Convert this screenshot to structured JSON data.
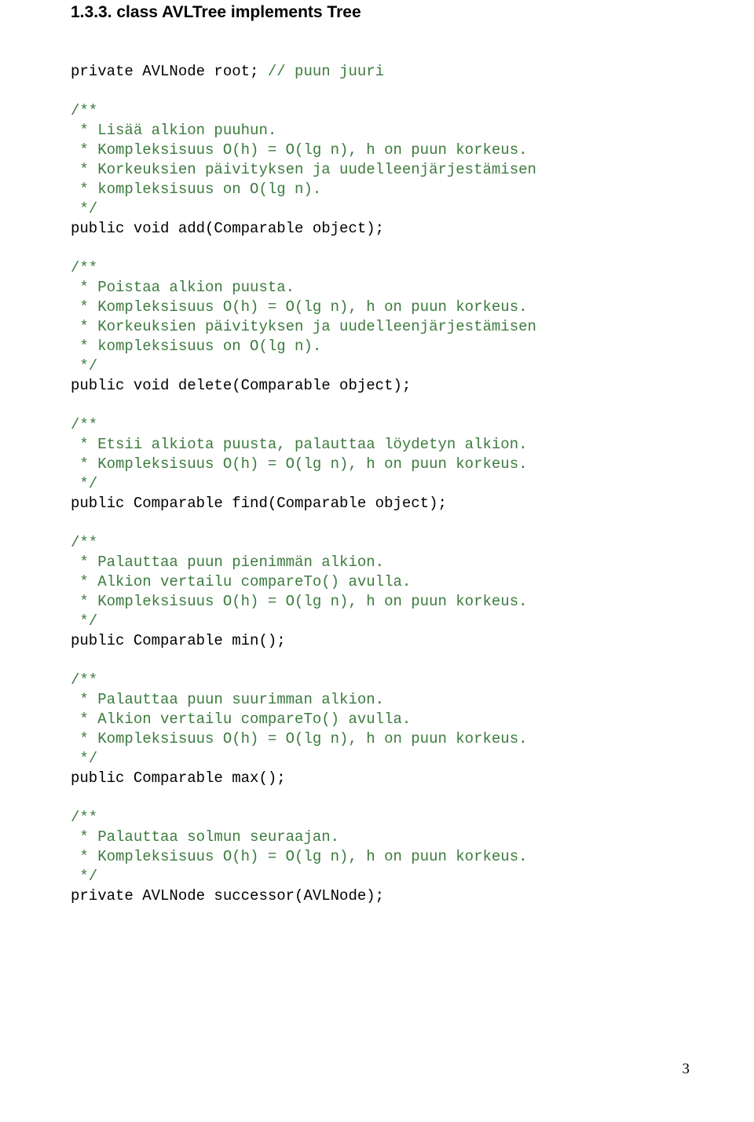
{
  "heading": "1.3.3. class AVLTree implements Tree",
  "lines": [
    {
      "kind": "blank"
    },
    {
      "kind": "mixed",
      "code": "private AVLNode root; ",
      "comment": "// puun juuri"
    },
    {
      "kind": "blank"
    },
    {
      "kind": "comment",
      "text": "/**"
    },
    {
      "kind": "comment",
      "text": " * Lisää alkion puuhun."
    },
    {
      "kind": "comment",
      "text": " * Kompleksisuus O(h) = O(lg n), h on puun korkeus."
    },
    {
      "kind": "comment",
      "text": " * Korkeuksien päivityksen ja uudelleenjärjestämisen"
    },
    {
      "kind": "comment",
      "text": " * kompleksisuus on O(lg n)."
    },
    {
      "kind": "comment",
      "text": " */"
    },
    {
      "kind": "code",
      "text": "public void add(Comparable object);"
    },
    {
      "kind": "blank"
    },
    {
      "kind": "comment",
      "text": "/**"
    },
    {
      "kind": "comment",
      "text": " * Poistaa alkion puusta."
    },
    {
      "kind": "comment",
      "text": " * Kompleksisuus O(h) = O(lg n), h on puun korkeus."
    },
    {
      "kind": "comment",
      "text": " * Korkeuksien päivityksen ja uudelleenjärjestämisen"
    },
    {
      "kind": "comment",
      "text": " * kompleksisuus on O(lg n)."
    },
    {
      "kind": "comment",
      "text": " */"
    },
    {
      "kind": "code",
      "text": "public void delete(Comparable object);"
    },
    {
      "kind": "blank"
    },
    {
      "kind": "comment",
      "text": "/**"
    },
    {
      "kind": "comment",
      "text": " * Etsii alkiota puusta, palauttaa löydetyn alkion."
    },
    {
      "kind": "comment",
      "text": " * Kompleksisuus O(h) = O(lg n), h on puun korkeus."
    },
    {
      "kind": "comment",
      "text": " */"
    },
    {
      "kind": "code",
      "text": "public Comparable find(Comparable object);"
    },
    {
      "kind": "blank"
    },
    {
      "kind": "comment",
      "text": "/**"
    },
    {
      "kind": "comment",
      "text": " * Palauttaa puun pienimmän alkion."
    },
    {
      "kind": "comment",
      "text": " * Alkion vertailu compareTo() avulla."
    },
    {
      "kind": "comment",
      "text": " * Kompleksisuus O(h) = O(lg n), h on puun korkeus."
    },
    {
      "kind": "comment",
      "text": " */"
    },
    {
      "kind": "code",
      "text": "public Comparable min();"
    },
    {
      "kind": "blank"
    },
    {
      "kind": "comment",
      "text": "/**"
    },
    {
      "kind": "comment",
      "text": " * Palauttaa puun suurimman alkion."
    },
    {
      "kind": "comment",
      "text": " * Alkion vertailu compareTo() avulla."
    },
    {
      "kind": "comment",
      "text": " * Kompleksisuus O(h) = O(lg n), h on puun korkeus."
    },
    {
      "kind": "comment",
      "text": " */"
    },
    {
      "kind": "code",
      "text": "public Comparable max();"
    },
    {
      "kind": "blank"
    },
    {
      "kind": "comment",
      "text": "/**"
    },
    {
      "kind": "comment",
      "text": " * Palauttaa solmun seuraajan."
    },
    {
      "kind": "comment",
      "text": " * Kompleksisuus O(h) = O(lg n), h on puun korkeus."
    },
    {
      "kind": "comment",
      "text": " */"
    },
    {
      "kind": "code",
      "text": "private AVLNode successor(AVLNode);"
    }
  ],
  "page_number": "3"
}
